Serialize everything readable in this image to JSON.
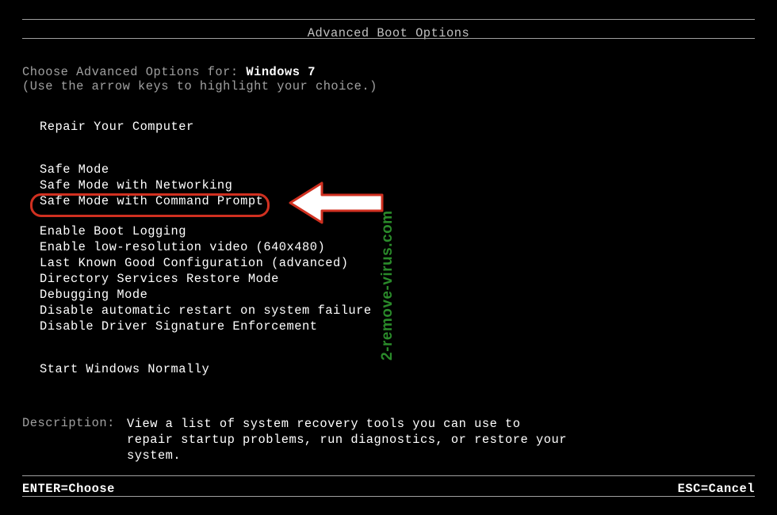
{
  "title": "Advanced Boot Options",
  "choose_label": "Choose Advanced Options for: ",
  "os_name": "Windows 7",
  "instruction": "(Use the arrow keys to highlight your choice.)",
  "menu": {
    "repair": "Repair Your Computer",
    "safe_mode": "Safe Mode",
    "safe_mode_net": "Safe Mode with Networking",
    "safe_mode_cmd": "Safe Mode with Command Prompt",
    "boot_logging": "Enable Boot Logging",
    "low_res": "Enable low-resolution video (640x480)",
    "last_known": "Last Known Good Configuration (advanced)",
    "ds_restore": "Directory Services Restore Mode",
    "debugging": "Debugging Mode",
    "disable_restart": "Disable automatic restart on system failure",
    "disable_sig": "Disable Driver Signature Enforcement",
    "start_normal": "Start Windows Normally"
  },
  "description": {
    "label": "Description:",
    "text": "View a list of system recovery tools you can use to repair startup problems, run diagnostics, or restore your system."
  },
  "footer": {
    "enter": "ENTER=Choose",
    "esc": "ESC=Cancel"
  },
  "watermark": "2-remove-virus.com",
  "annotation": {
    "highlighted_option": "safe_mode_cmd",
    "arrow_color": "#ffffff",
    "arrow_outline": "#d03020",
    "circle_color": "#d03020"
  }
}
